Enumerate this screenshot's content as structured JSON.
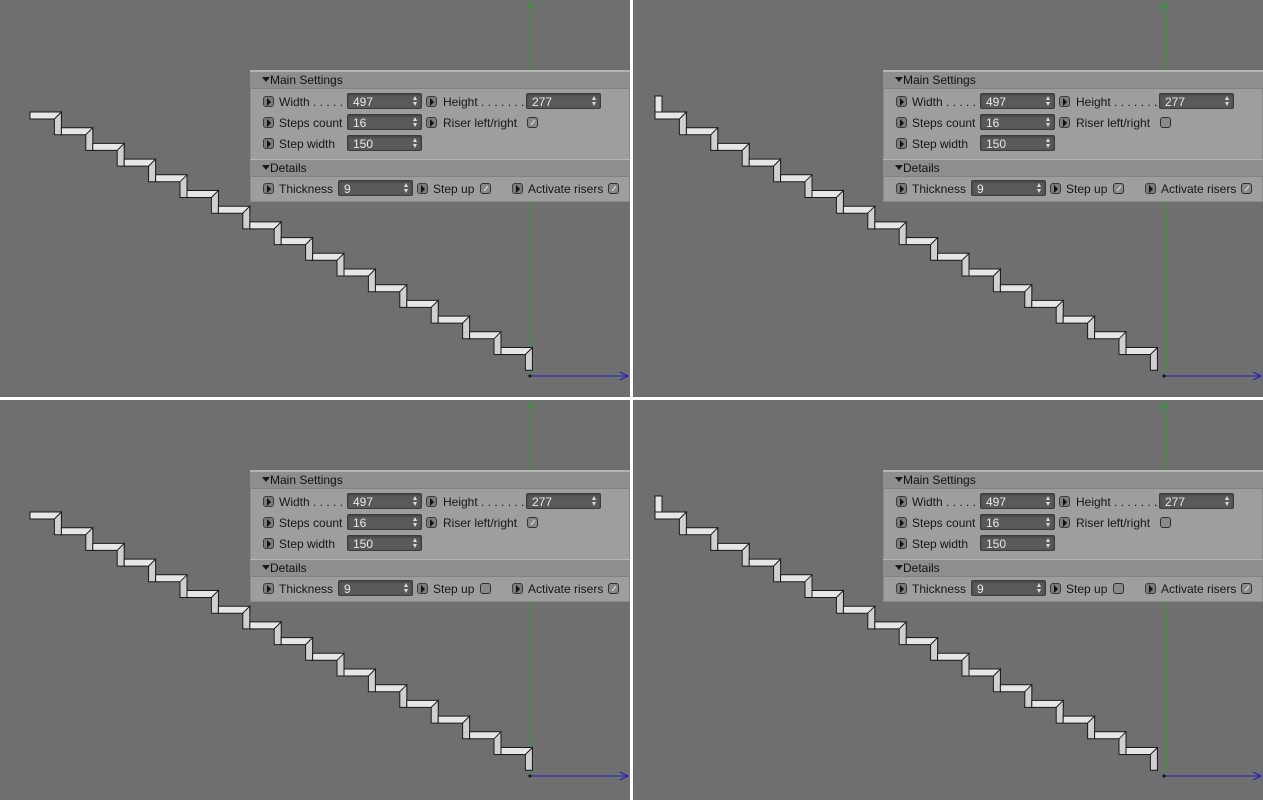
{
  "colors": {
    "viewport_bg": "#6f6f6f",
    "panel_bg": "#9e9e9e",
    "field_bg": "#5a5a5a",
    "y_axis": "#2e9e2e",
    "x_axis": "#2020c8",
    "stair_fill": "#e6e6e6",
    "stair_stroke": "#1a1a1a"
  },
  "views": [
    {
      "main_settings": {
        "header": "Main Settings",
        "width_label": "Width . . . . .",
        "width_value": "497",
        "height_label": "Height . . . . . . .",
        "height_value": "277",
        "steps_label": "Steps count",
        "steps_value": "16",
        "riser_lr_label": "Riser left/right",
        "riser_lr_checked": true,
        "step_width_label": "Step width",
        "step_width_value": "150"
      },
      "details": {
        "header": "Details",
        "thickness_label": "Thickness",
        "thickness_value": "9",
        "step_up_label": "Step up",
        "step_up_checked": true,
        "activate_risers_label": "Activate risers",
        "activate_risers_checked": true
      }
    },
    {
      "main_settings": {
        "header": "Main Settings",
        "width_label": "Width . . . . .",
        "width_value": "497",
        "height_label": "Height . . . . . . .",
        "height_value": "277",
        "steps_label": "Steps count",
        "steps_value": "16",
        "riser_lr_label": "Riser left/right",
        "riser_lr_checked": false,
        "step_width_label": "Step width",
        "step_width_value": "150"
      },
      "details": {
        "header": "Details",
        "thickness_label": "Thickness",
        "thickness_value": "9",
        "step_up_label": "Step up",
        "step_up_checked": true,
        "activate_risers_label": "Activate risers",
        "activate_risers_checked": true
      }
    },
    {
      "main_settings": {
        "header": "Main Settings",
        "width_label": "Width . . . . .",
        "width_value": "497",
        "height_label": "Height . . . . . . .",
        "height_value": "277",
        "steps_label": "Steps count",
        "steps_value": "16",
        "riser_lr_label": "Riser left/right",
        "riser_lr_checked": true,
        "step_width_label": "Step width",
        "step_width_value": "150"
      },
      "details": {
        "header": "Details",
        "thickness_label": "Thickness",
        "thickness_value": "9",
        "step_up_label": "Step up",
        "step_up_checked": false,
        "activate_risers_label": "Activate risers",
        "activate_risers_checked": true
      }
    },
    {
      "main_settings": {
        "header": "Main Settings",
        "width_label": "Width . . . . .",
        "width_value": "497",
        "height_label": "Height . . . . . . .",
        "height_value": "277",
        "steps_label": "Steps count",
        "steps_value": "16",
        "riser_lr_label": "Riser left/right",
        "riser_lr_checked": false,
        "step_width_label": "Step width",
        "step_width_value": "150"
      },
      "details": {
        "header": "Details",
        "thickness_label": "Thickness",
        "thickness_value": "9",
        "step_up_label": "Step up",
        "step_up_checked": false,
        "activate_risers_label": "Activate risers",
        "activate_risers_checked": true
      }
    }
  ]
}
